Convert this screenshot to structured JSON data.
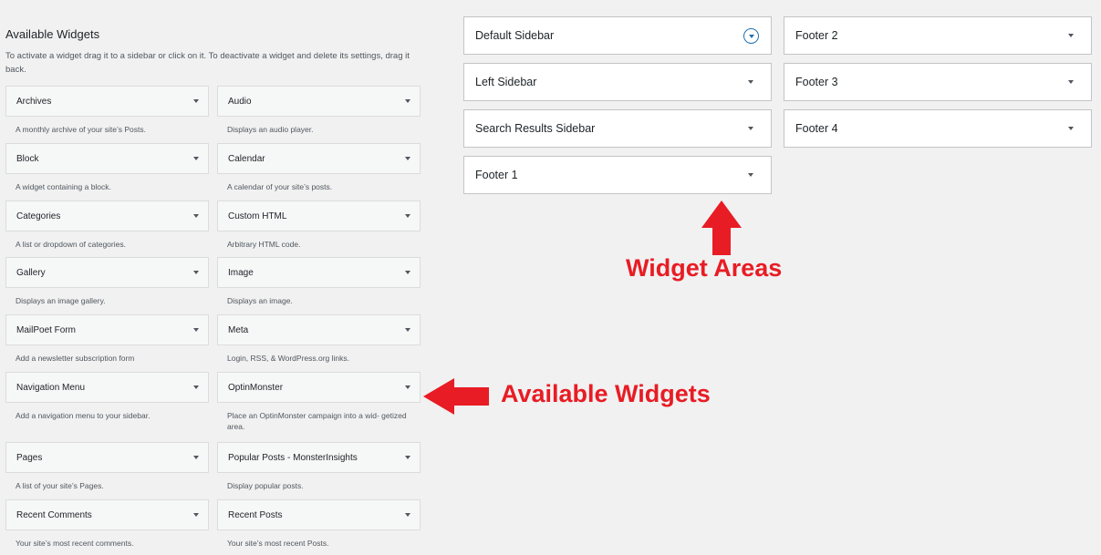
{
  "available_widgets": {
    "title": "Available Widgets",
    "description": "To activate a widget drag it to a sidebar or click on it. To deactivate a widget and delete its settings, drag it back.",
    "items": [
      {
        "name": "Archives",
        "desc": "A monthly archive of your site’s Posts."
      },
      {
        "name": "Audio",
        "desc": "Displays an audio player."
      },
      {
        "name": "Block",
        "desc": "A widget containing a block."
      },
      {
        "name": "Calendar",
        "desc": "A calendar of your site’s posts."
      },
      {
        "name": "Categories",
        "desc": "A list or dropdown of categories."
      },
      {
        "name": "Custom HTML",
        "desc": "Arbitrary HTML code."
      },
      {
        "name": "Gallery",
        "desc": "Displays an image gallery."
      },
      {
        "name": "Image",
        "desc": "Displays an image."
      },
      {
        "name": "MailPoet Form",
        "desc": "Add a newsletter subscription form"
      },
      {
        "name": "Meta",
        "desc": "Login, RSS, & WordPress.org links."
      },
      {
        "name": "Navigation Menu",
        "desc": "Add a navigation menu to your sidebar."
      },
      {
        "name": "OptinMonster",
        "desc": "Place an OptinMonster campaign into a wid- getized area."
      },
      {
        "name": "Pages",
        "desc": "A list of your site’s Pages."
      },
      {
        "name": "Popular Posts - MonsterInsights",
        "desc": "Display popular posts."
      },
      {
        "name": "Recent Comments",
        "desc": "Your site’s most recent comments."
      },
      {
        "name": "Recent Posts",
        "desc": "Your site’s most recent Posts."
      }
    ]
  },
  "widget_areas": [
    {
      "name": "Default Sidebar",
      "icon": "circle-arrow-icon"
    },
    {
      "name": "Footer 2",
      "icon": "arrow-down-icon"
    },
    {
      "name": "Left Sidebar",
      "icon": "arrow-down-icon"
    },
    {
      "name": "Footer 3",
      "icon": "arrow-down-icon"
    },
    {
      "name": "Search Results Sidebar",
      "icon": "arrow-down-icon"
    },
    {
      "name": "Footer 4",
      "icon": "arrow-down-icon"
    },
    {
      "name": "Footer 1",
      "icon": "arrow-down-icon"
    }
  ],
  "annotations": {
    "widget_areas_label": "Widget Areas",
    "available_widgets_label": "Available Widgets",
    "color": "#e81c24"
  }
}
